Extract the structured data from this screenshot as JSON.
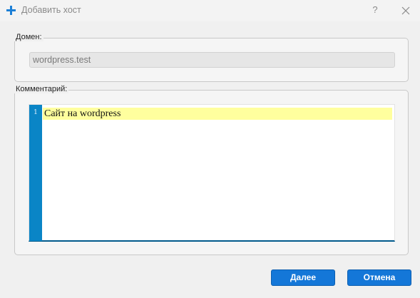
{
  "window": {
    "title": "Добавить хост",
    "help_label": "?",
    "add_icon": "plus-icon",
    "close_icon": "close-icon",
    "accent_color": "#1477d8"
  },
  "domain": {
    "label": "Домен:",
    "value": "wordpress.test"
  },
  "comment": {
    "label": "Комментарий:",
    "lines": [
      {
        "number": "1",
        "text": "Сайт на wordpress"
      }
    ],
    "gutter_color": "#0a85c6",
    "highlight_color": "#ffff9e"
  },
  "buttons": {
    "next_label": "Далее",
    "cancel_label": "Отмена"
  }
}
